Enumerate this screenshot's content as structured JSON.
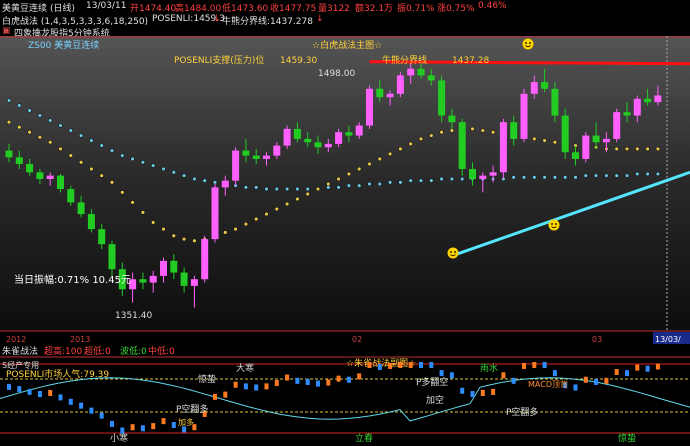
{
  "header": {
    "instrument": "美黄豆连续",
    "period": "(日线)",
    "date": "13/03/11",
    "open": "开1474.40",
    "high": "高1484.00",
    "low": "低1473.60",
    "close": "收1477.75",
    "volume": "量3122",
    "change": "额32.1万",
    "amplitude": "振0.71%",
    "pct": "涨0.75%",
    "pct2": "0.46%"
  },
  "header2": {
    "indicator": "白虎战法 (1,4,3,5,3,3,3,6,18,250)",
    "posenli": "POSENLI:1459.3",
    "posenli_arrow": "↓",
    "boundary": "牛熊分界线:1437.278",
    "boundary_arrow": "↓"
  },
  "header3": {
    "note": "四象擒龙股指5分钟系统"
  },
  "chart": {
    "corner_label": "ZS00 美黄豆连续",
    "title_annot": "☆白虎战法主图☆",
    "posenli_annot": "POSENLI支撑(压力)位",
    "posenli_value": "1459.30",
    "boundary_annot": "牛熊分界线",
    "boundary_value": "1437.28",
    "high_label": "1498.00",
    "low_label": "1351.40",
    "swing_text": "当日振幅:0.71% 10.45元",
    "date_labels": [
      "2012",
      "2013",
      "02",
      "03",
      "13/03/"
    ]
  },
  "chart_data": {
    "type": "candlestick",
    "y_range": [
      1340,
      1510
    ],
    "candles": [
      {
        "o": 1445,
        "h": 1449,
        "l": 1438,
        "c": 1441
      },
      {
        "o": 1441,
        "h": 1445,
        "l": 1434,
        "c": 1437
      },
      {
        "o": 1437,
        "h": 1440,
        "l": 1430,
        "c": 1432
      },
      {
        "o": 1432,
        "h": 1434,
        "l": 1425,
        "c": 1428
      },
      {
        "o": 1428,
        "h": 1432,
        "l": 1424,
        "c": 1430
      },
      {
        "o": 1430,
        "h": 1431,
        "l": 1420,
        "c": 1422
      },
      {
        "o": 1422,
        "h": 1424,
        "l": 1412,
        "c": 1414
      },
      {
        "o": 1414,
        "h": 1418,
        "l": 1405,
        "c": 1407
      },
      {
        "o": 1407,
        "h": 1410,
        "l": 1396,
        "c": 1398
      },
      {
        "o": 1398,
        "h": 1401,
        "l": 1386,
        "c": 1389
      },
      {
        "o": 1389,
        "h": 1391,
        "l": 1370,
        "c": 1374
      },
      {
        "o": 1374,
        "h": 1378,
        "l": 1358,
        "c": 1362
      },
      {
        "o": 1362,
        "h": 1372,
        "l": 1354,
        "c": 1368
      },
      {
        "o": 1368,
        "h": 1372,
        "l": 1362,
        "c": 1366
      },
      {
        "o": 1366,
        "h": 1373,
        "l": 1360,
        "c": 1370
      },
      {
        "o": 1370,
        "h": 1381,
        "l": 1366,
        "c": 1379
      },
      {
        "o": 1379,
        "h": 1383,
        "l": 1368,
        "c": 1372
      },
      {
        "o": 1372,
        "h": 1375,
        "l": 1360,
        "c": 1364
      },
      {
        "o": 1364,
        "h": 1370,
        "l": 1351,
        "c": 1368
      },
      {
        "o": 1368,
        "h": 1394,
        "l": 1366,
        "c": 1392
      },
      {
        "o": 1392,
        "h": 1425,
        "l": 1390,
        "c": 1423
      },
      {
        "o": 1423,
        "h": 1430,
        "l": 1418,
        "c": 1427
      },
      {
        "o": 1427,
        "h": 1447,
        "l": 1424,
        "c": 1445
      },
      {
        "o": 1445,
        "h": 1452,
        "l": 1438,
        "c": 1442
      },
      {
        "o": 1442,
        "h": 1446,
        "l": 1437,
        "c": 1440
      },
      {
        "o": 1440,
        "h": 1444,
        "l": 1436,
        "c": 1442
      },
      {
        "o": 1442,
        "h": 1450,
        "l": 1440,
        "c": 1448
      },
      {
        "o": 1448,
        "h": 1460,
        "l": 1446,
        "c": 1458
      },
      {
        "o": 1458,
        "h": 1462,
        "l": 1450,
        "c": 1452
      },
      {
        "o": 1452,
        "h": 1456,
        "l": 1447,
        "c": 1450
      },
      {
        "o": 1450,
        "h": 1454,
        "l": 1443,
        "c": 1447
      },
      {
        "o": 1447,
        "h": 1452,
        "l": 1444,
        "c": 1449
      },
      {
        "o": 1449,
        "h": 1458,
        "l": 1447,
        "c": 1456
      },
      {
        "o": 1456,
        "h": 1460,
        "l": 1450,
        "c": 1454
      },
      {
        "o": 1454,
        "h": 1462,
        "l": 1452,
        "c": 1460
      },
      {
        "o": 1460,
        "h": 1484,
        "l": 1458,
        "c": 1482
      },
      {
        "o": 1482,
        "h": 1487,
        "l": 1474,
        "c": 1477
      },
      {
        "o": 1477,
        "h": 1481,
        "l": 1472,
        "c": 1479
      },
      {
        "o": 1479,
        "h": 1492,
        "l": 1477,
        "c": 1490
      },
      {
        "o": 1490,
        "h": 1498,
        "l": 1485,
        "c": 1494
      },
      {
        "o": 1494,
        "h": 1497,
        "l": 1488,
        "c": 1490
      },
      {
        "o": 1490,
        "h": 1494,
        "l": 1484,
        "c": 1487
      },
      {
        "o": 1487,
        "h": 1490,
        "l": 1462,
        "c": 1466
      },
      {
        "o": 1466,
        "h": 1470,
        "l": 1458,
        "c": 1462
      },
      {
        "o": 1462,
        "h": 1464,
        "l": 1430,
        "c": 1434
      },
      {
        "o": 1434,
        "h": 1438,
        "l": 1424,
        "c": 1428
      },
      {
        "o": 1428,
        "h": 1432,
        "l": 1420,
        "c": 1430
      },
      {
        "o": 1430,
        "h": 1436,
        "l": 1426,
        "c": 1432
      },
      {
        "o": 1432,
        "h": 1464,
        "l": 1428,
        "c": 1462
      },
      {
        "o": 1462,
        "h": 1466,
        "l": 1448,
        "c": 1452
      },
      {
        "o": 1452,
        "h": 1482,
        "l": 1450,
        "c": 1479
      },
      {
        "o": 1479,
        "h": 1490,
        "l": 1476,
        "c": 1486
      },
      {
        "o": 1486,
        "h": 1494,
        "l": 1480,
        "c": 1482
      },
      {
        "o": 1482,
        "h": 1486,
        "l": 1462,
        "c": 1466
      },
      {
        "o": 1466,
        "h": 1470,
        "l": 1440,
        "c": 1444
      },
      {
        "o": 1444,
        "h": 1448,
        "l": 1436,
        "c": 1440
      },
      {
        "o": 1440,
        "h": 1456,
        "l": 1438,
        "c": 1454
      },
      {
        "o": 1454,
        "h": 1462,
        "l": 1446,
        "c": 1450
      },
      {
        "o": 1450,
        "h": 1456,
        "l": 1444,
        "c": 1452
      },
      {
        "o": 1452,
        "h": 1470,
        "l": 1450,
        "c": 1468
      },
      {
        "o": 1468,
        "h": 1474,
        "l": 1462,
        "c": 1466
      },
      {
        "o": 1466,
        "h": 1478,
        "l": 1462,
        "c": 1476
      },
      {
        "o": 1476,
        "h": 1482,
        "l": 1472,
        "c": 1474
      },
      {
        "o": 1474,
        "h": 1484,
        "l": 1472,
        "c": 1478
      }
    ],
    "dots_dark": [
      1475,
      1472,
      1469,
      1466,
      1463,
      1460,
      1457,
      1454,
      1451,
      1448,
      1445,
      1442,
      1440,
      1438,
      1436,
      1434,
      1432,
      1430,
      1428,
      1427,
      1426,
      1425,
      1424,
      1423,
      1423,
      1422,
      1422,
      1422,
      1422,
      1422,
      1422,
      1423,
      1423,
      1424,
      1424,
      1425,
      1425,
      1426,
      1426,
      1427,
      1427,
      1427,
      1428,
      1428,
      1428,
      1428,
      1428,
      1428,
      1428,
      1429,
      1429,
      1429,
      1429,
      1429,
      1429,
      1429,
      1430,
      1430,
      1430,
      1430,
      1430,
      1431,
      1431,
      1431
    ],
    "dots_yellow": [
      1462,
      1459,
      1456,
      1453,
      1450,
      1446,
      1442,
      1438,
      1434,
      1430,
      1426,
      1420,
      1414,
      1408,
      1402,
      1398,
      1394,
      1392,
      1391,
      1392,
      1394,
      1396,
      1398,
      1401,
      1404,
      1407,
      1410,
      1413,
      1416,
      1419,
      1422,
      1425,
      1428,
      1431,
      1434,
      1437,
      1440,
      1443,
      1446,
      1449,
      1452,
      1454,
      1456,
      1457,
      1458,
      1458,
      1457,
      1456,
      1455,
      1454,
      1453,
      1452,
      1451,
      1450,
      1449,
      1448,
      1447,
      1447,
      1446,
      1446,
      1446,
      1446,
      1446,
      1446
    ],
    "support_line": {
      "from_index": 47,
      "to_index": 70,
      "from_value": 1382,
      "to_value": 1432
    },
    "resistance_value": 1497
  },
  "indicator_panel": {
    "title": "朱雀战法",
    "superhigh": "超高:100",
    "superlow": "超低:0",
    "bowlow": "波低:0",
    "midlow": "中低:0",
    "title_annot": "☆朱雀战法副图☆",
    "left_label": "S经产专用",
    "mood": "POSENLI市场人气:79.39",
    "terms": [
      "小寒",
      "大寒",
      "惊蛰",
      "立春",
      "雨水",
      "惊蛰"
    ],
    "signals": [
      "P空翻多",
      "P空翻多",
      "P多翻空",
      "加空",
      "P空翻多",
      "MACD顶背"
    ],
    "secondary": [
      "加多",
      "MACD顶背"
    ]
  },
  "colors": {
    "up": "#ff60ff",
    "down": "#22cc22",
    "red_line": "#ff1010",
    "cyan_line": "#55e6ff",
    "annotation": "#ffd23c"
  }
}
